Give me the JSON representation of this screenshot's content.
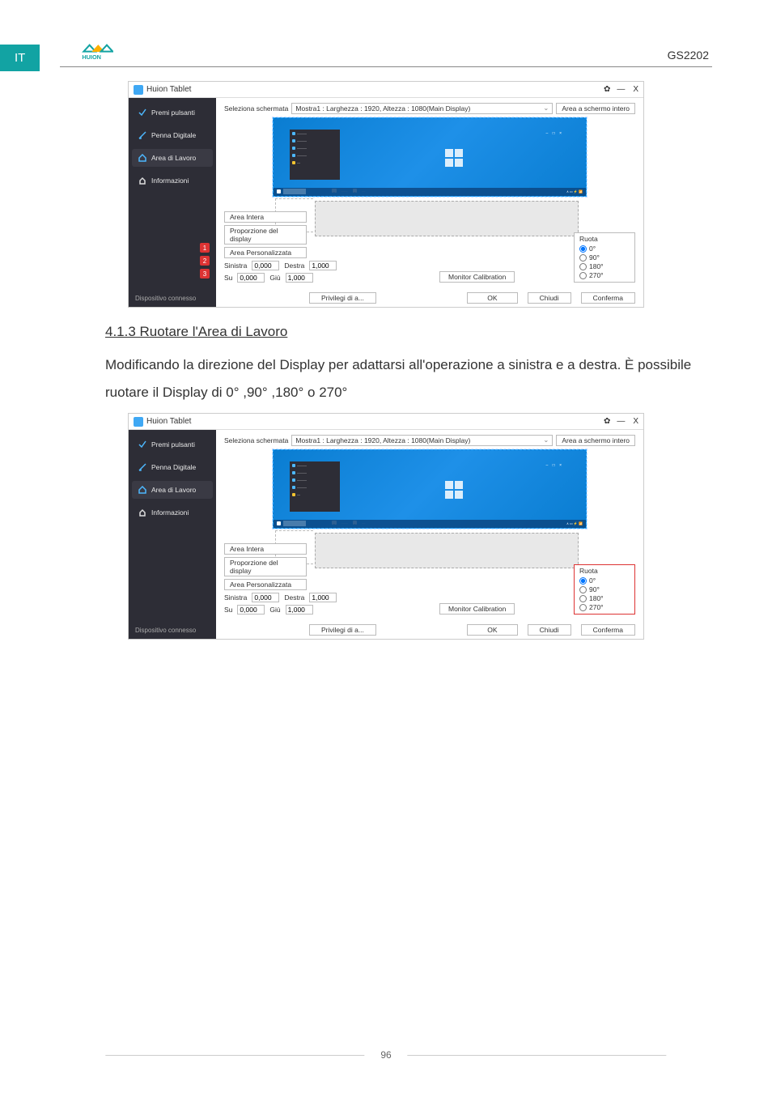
{
  "page": {
    "lang": "IT",
    "model": "GS2202",
    "number": "96",
    "logo_text": "HUION"
  },
  "section": {
    "title": "4.1.3 Ruotare l'Area di Lavoro",
    "body": "Modificando la direzione del Display per adattarsi all'operazione a sinistra e a destra. È possibile ruotare il Display di 0° ,90° ,180° o 270°"
  },
  "app": {
    "title": "Huion Tablet",
    "sidebar": {
      "items": [
        "Premi pulsanti",
        "Penna Digitale",
        "Area di Lavoro",
        "Informazioni"
      ],
      "footer": "Dispositivo connesso"
    },
    "topbar": {
      "label": "Seleziona schermata",
      "selected": "Mostra1 : Larghezza : 1920, Altezza : 1080(Main Display)",
      "fullscreen_btn": "Area a schermo intero"
    },
    "area_buttons": {
      "full": "Area Intera",
      "ratio": "Proporzione del display",
      "custom": "Area Personalizzata"
    },
    "inputs": {
      "left_label": "Sinistra",
      "left_value": "0,000",
      "right_label": "Destra",
      "right_value": "1,000",
      "up_label": "Su",
      "up_value": "0,000",
      "down_label": "Giù",
      "down_value": "1,000"
    },
    "monitor_cal": "Monitor Calibration",
    "rotate": {
      "title": "Ruota",
      "options": [
        "0°",
        "90°",
        "180°",
        "270°"
      ],
      "selected": "0°"
    },
    "footer": {
      "priv": "Privilegi di a...",
      "ok": "OK",
      "close": "Chiudi",
      "confirm": "Conferma"
    },
    "markers": [
      "1",
      "2",
      "3"
    ]
  }
}
